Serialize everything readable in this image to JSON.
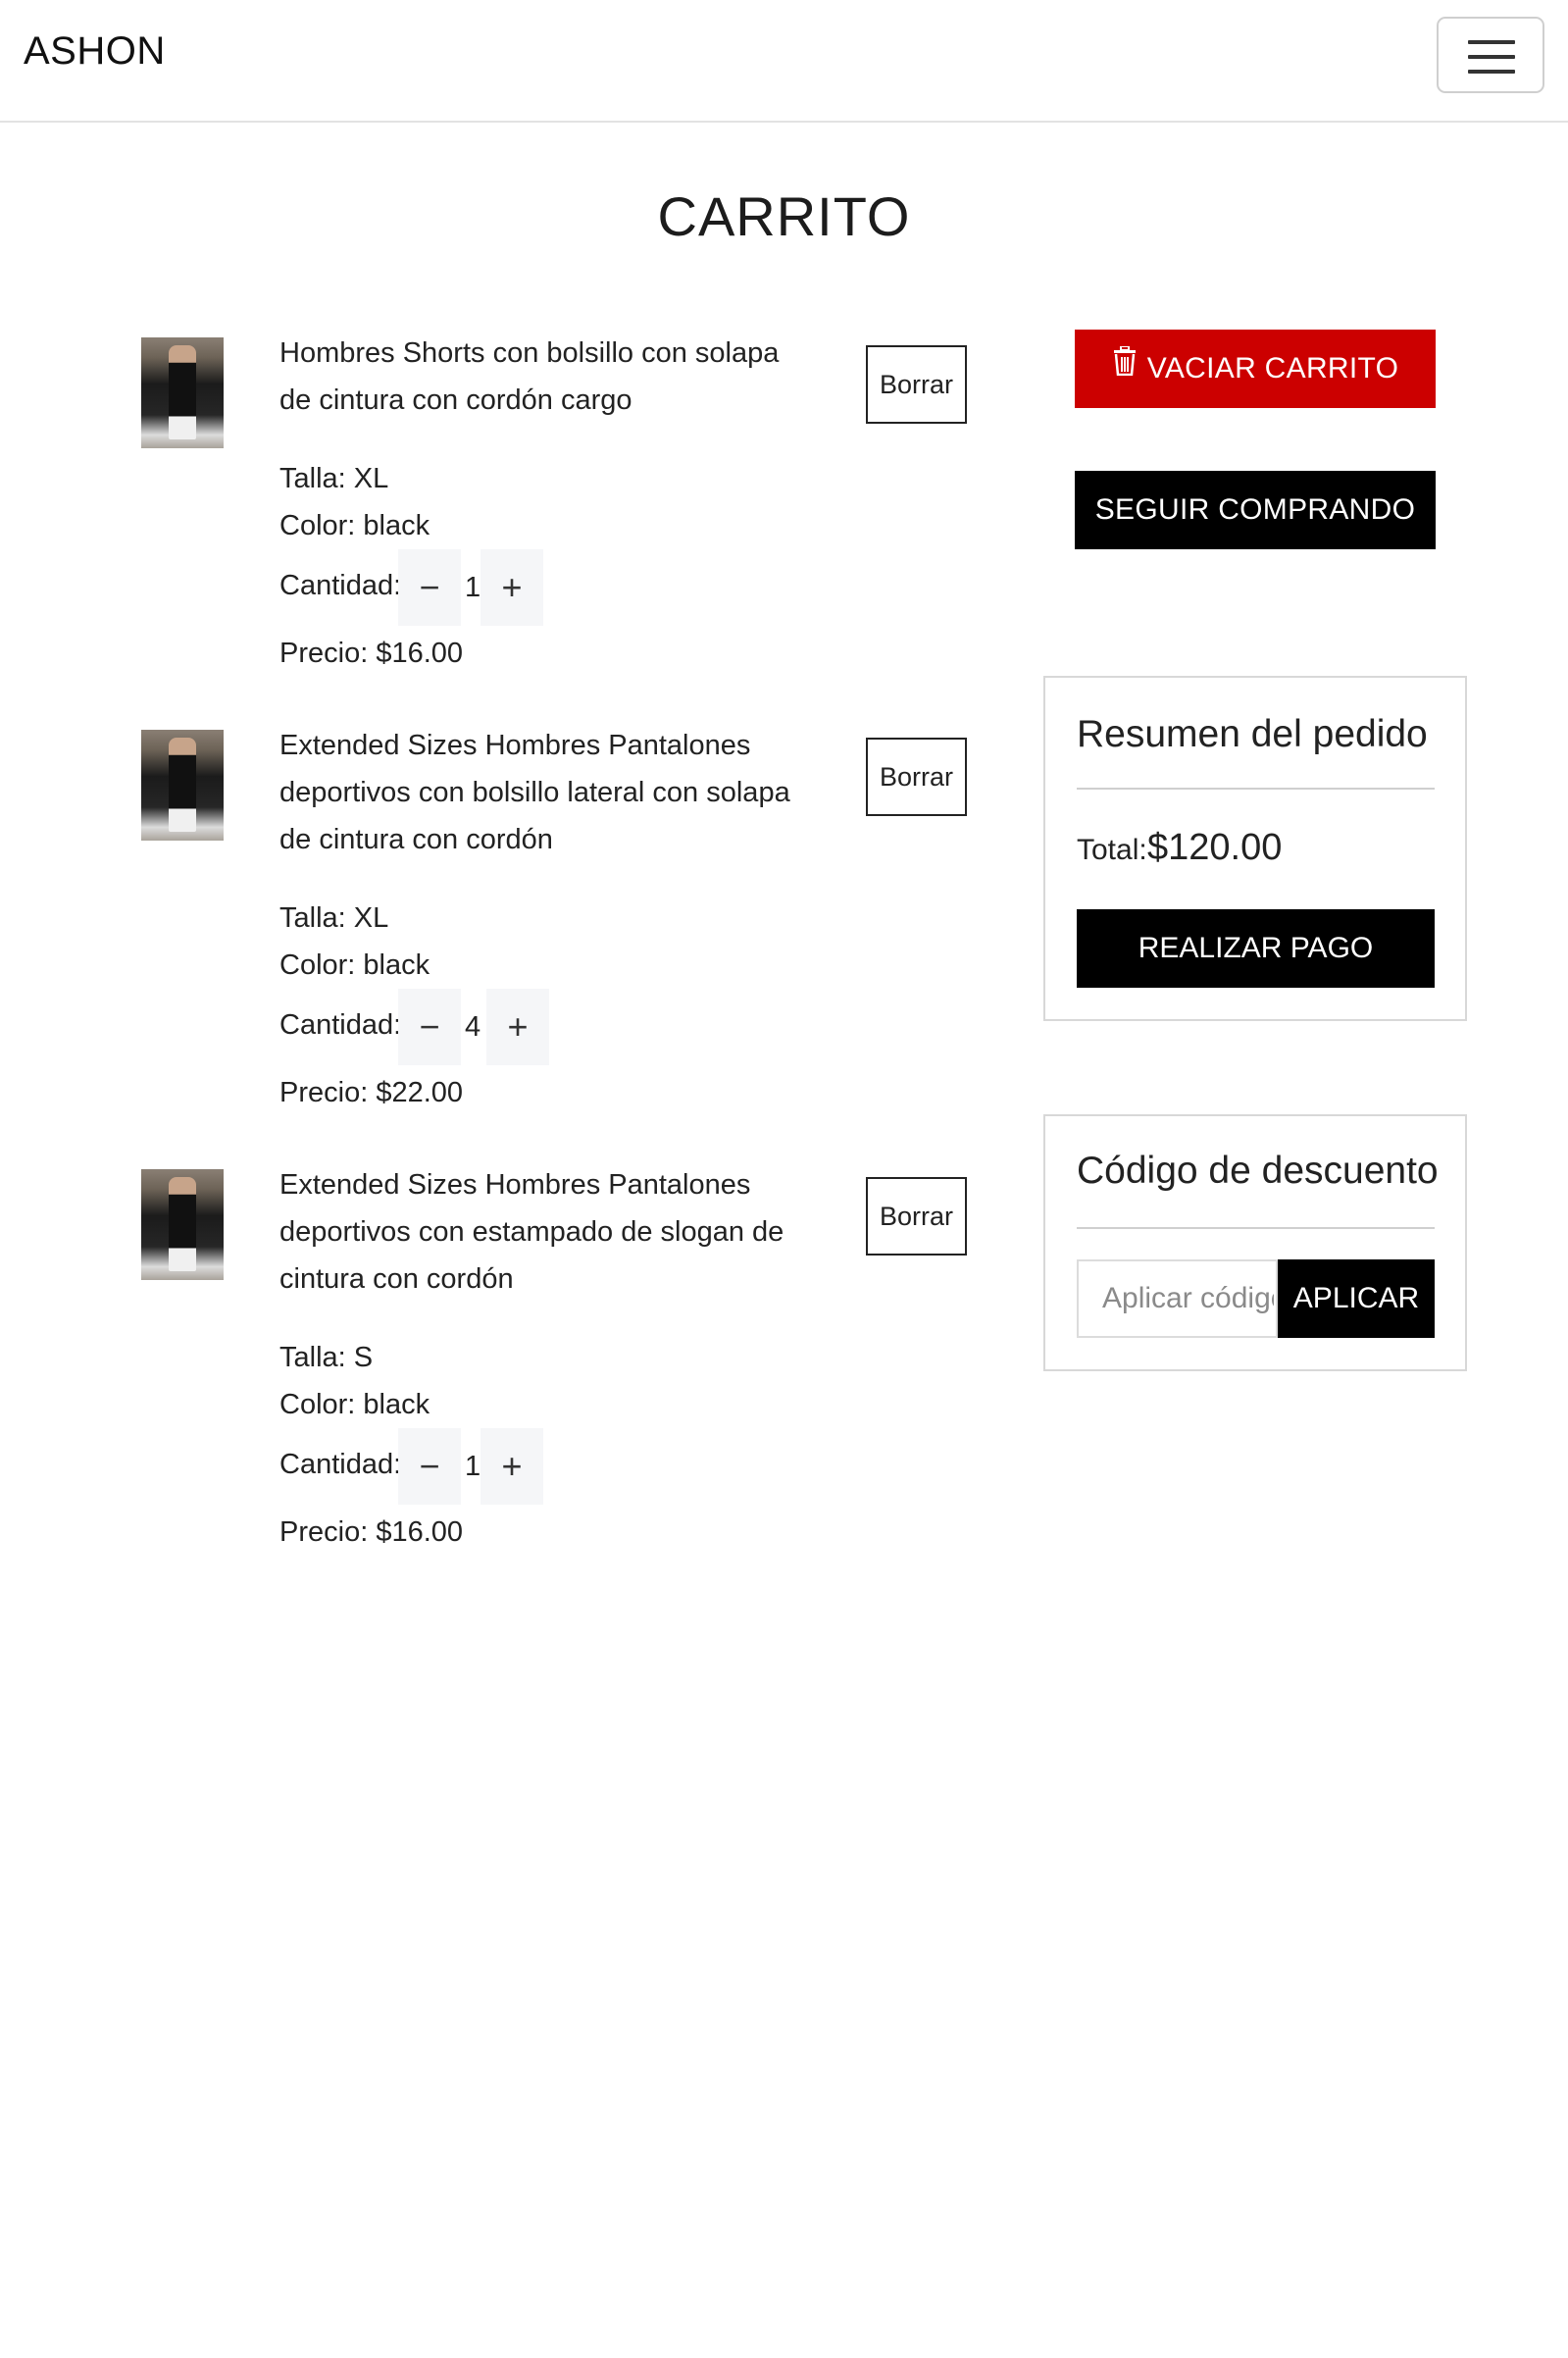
{
  "navbar": {
    "brand": "ASHON",
    "menu_icon": "hamburger-menu-icon"
  },
  "page": {
    "title": "CARRITO"
  },
  "cart": {
    "items": [
      {
        "title": "Hombres Shorts con bolsillo con solapa de cintura con cordón cargo",
        "size": "Talla: XL",
        "color": "Color: black",
        "qty_label": "Cantidad:",
        "quantity": "1",
        "price": "Precio: $16.00",
        "remove_label": "Borrar",
        "minus": "−",
        "plus": "+"
      },
      {
        "title": "Extended Sizes Hombres Pantalones deportivos con bolsillo lateral con solapa de cintura con cordón",
        "size": "Talla: XL",
        "color": "Color: black",
        "qty_label": "Cantidad:",
        "quantity": "4",
        "price": "Precio: $22.00",
        "remove_label": "Borrar",
        "minus": "−",
        "plus": "+"
      },
      {
        "title": "Extended Sizes Hombres Pantalones deportivos con estampado de slogan de cintura con cordón",
        "size": "Talla: S",
        "color": "Color: black",
        "qty_label": "Cantidad:",
        "quantity": "1",
        "price": "Precio: $16.00",
        "remove_label": "Borrar",
        "minus": "−",
        "plus": "+"
      }
    ]
  },
  "actions": {
    "empty_cart_label": "VACIAR CARRITO",
    "empty_cart_icon": "trash-icon",
    "continue_label": "SEGUIR COMPRANDO"
  },
  "summary": {
    "heading": "Resumen del pedido",
    "total_label": "Total:",
    "total_value": "$120.00",
    "pay_label": "REALIZAR PAGO"
  },
  "discount": {
    "heading": "Código de descuento",
    "placeholder": "Aplicar código",
    "apply_label": "APLICAR"
  },
  "colors": {
    "danger": "#cc0000",
    "primary": "#000000",
    "qty_button_bg": "#f5f6f8"
  }
}
